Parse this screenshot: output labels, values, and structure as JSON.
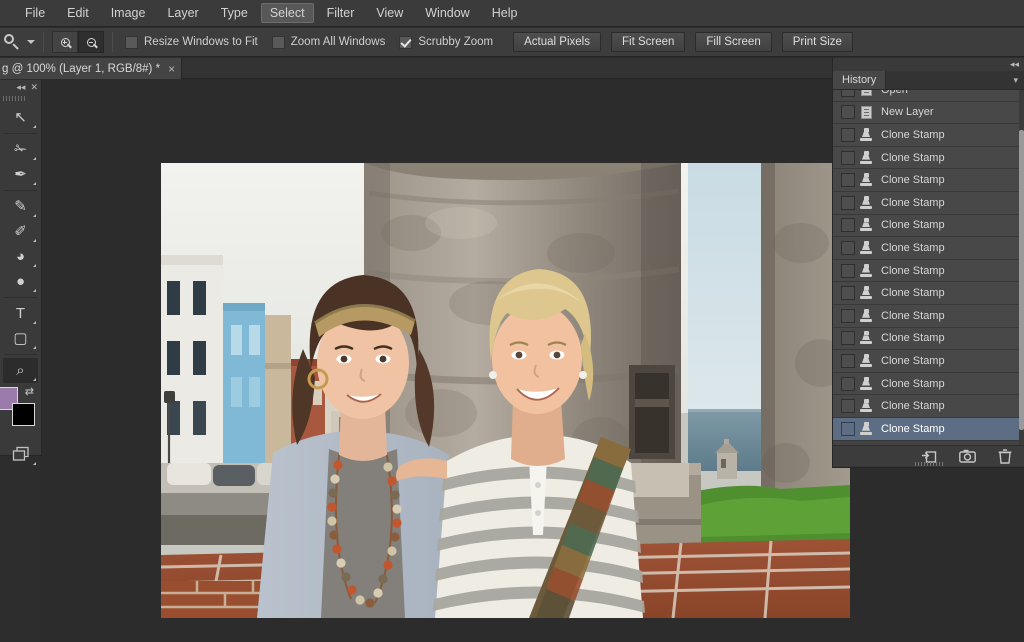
{
  "app": {
    "name": "Adobe Photoshop",
    "theme_bg": "#2d2d2d",
    "accent_selected": "#5d6e84"
  },
  "menubar": {
    "items": [
      {
        "label": "File",
        "active": false
      },
      {
        "label": "Edit",
        "active": false
      },
      {
        "label": "Image",
        "active": false
      },
      {
        "label": "Layer",
        "active": false
      },
      {
        "label": "Type",
        "active": false
      },
      {
        "label": "Select",
        "active": true
      },
      {
        "label": "Filter",
        "active": false
      },
      {
        "label": "View",
        "active": false
      },
      {
        "label": "Window",
        "active": false
      },
      {
        "label": "Help",
        "active": false
      }
    ]
  },
  "options_bar": {
    "active_tool_icon": "zoom-tool-icon",
    "zoom_in_title": "Zoom In",
    "zoom_out_title": "Zoom Out",
    "zoom_out_selected": true,
    "checkboxes": [
      {
        "label": "Resize Windows to Fit",
        "checked": false
      },
      {
        "label": "Zoom All Windows",
        "checked": false
      },
      {
        "label": "Scrubby Zoom",
        "checked": true
      }
    ],
    "buttons": [
      {
        "label": "Actual Pixels"
      },
      {
        "label": "Fit Screen"
      },
      {
        "label": "Fill Screen"
      },
      {
        "label": "Print Size"
      }
    ]
  },
  "document_tab": {
    "label": "g @ 100% (Layer 1, RGB/8#) *",
    "close_glyph": "×",
    "zoom_level": "100%",
    "layer_name": "Layer 1",
    "color_mode": "RGB/8#",
    "modified": true
  },
  "tools_panel": {
    "collapse_glyph": "◂◂",
    "close_glyph": "✕",
    "tools": [
      {
        "name": "move-tool",
        "glyph": "↖",
        "selected": false
      },
      {
        "name": "lasso-tool",
        "glyph": "✁",
        "selected": false
      },
      {
        "name": "eyedropper-tool",
        "glyph": "✒",
        "selected": false
      },
      {
        "name": "brush-tool",
        "glyph": "✎",
        "selected": false
      },
      {
        "name": "clone-stamp-tool",
        "glyph": "✐",
        "selected": false
      },
      {
        "name": "paint-bucket-tool",
        "glyph": "◕",
        "selected": false
      },
      {
        "name": "sponge-tool",
        "glyph": "●",
        "selected": false
      },
      {
        "name": "type-tool",
        "glyph": "T",
        "selected": false
      },
      {
        "name": "rectangle-shape-tool",
        "glyph": "▢",
        "selected": false
      },
      {
        "name": "zoom-tool",
        "glyph": "⌕",
        "selected": true
      }
    ],
    "foreground_color": "#9b7bab",
    "background_color": "#000000",
    "swap_glyph": "⇄",
    "screen_mode_glyph": "❐"
  },
  "history_panel": {
    "collapse_glyph": "◂◂",
    "tab_label": "History",
    "menu_glyph": "▾",
    "items": [
      {
        "label": "Open",
        "icon": "document-icon",
        "selected": false,
        "partial": true
      },
      {
        "label": "New Layer",
        "icon": "document-icon",
        "selected": false
      },
      {
        "label": "Clone Stamp",
        "icon": "clone-stamp-icon",
        "selected": false
      },
      {
        "label": "Clone Stamp",
        "icon": "clone-stamp-icon",
        "selected": false
      },
      {
        "label": "Clone Stamp",
        "icon": "clone-stamp-icon",
        "selected": false
      },
      {
        "label": "Clone Stamp",
        "icon": "clone-stamp-icon",
        "selected": false
      },
      {
        "label": "Clone Stamp",
        "icon": "clone-stamp-icon",
        "selected": false
      },
      {
        "label": "Clone Stamp",
        "icon": "clone-stamp-icon",
        "selected": false
      },
      {
        "label": "Clone Stamp",
        "icon": "clone-stamp-icon",
        "selected": false
      },
      {
        "label": "Clone Stamp",
        "icon": "clone-stamp-icon",
        "selected": false
      },
      {
        "label": "Clone Stamp",
        "icon": "clone-stamp-icon",
        "selected": false
      },
      {
        "label": "Clone Stamp",
        "icon": "clone-stamp-icon",
        "selected": false
      },
      {
        "label": "Clone Stamp",
        "icon": "clone-stamp-icon",
        "selected": false
      },
      {
        "label": "Clone Stamp",
        "icon": "clone-stamp-icon",
        "selected": false
      },
      {
        "label": "Clone Stamp",
        "icon": "clone-stamp-icon",
        "selected": false
      },
      {
        "label": "Clone Stamp",
        "icon": "clone-stamp-icon",
        "selected": true
      }
    ],
    "footer_buttons": [
      {
        "name": "create-document-from-state-button"
      },
      {
        "name": "create-snapshot-button"
      },
      {
        "name": "delete-state-button"
      }
    ]
  },
  "canvas": {
    "image_description": "Two women posing in front of a stone fortress at El Morro, Old San Juan, with colorful colonial buildings and the ocean behind",
    "background_color": "#2c2c2c"
  }
}
